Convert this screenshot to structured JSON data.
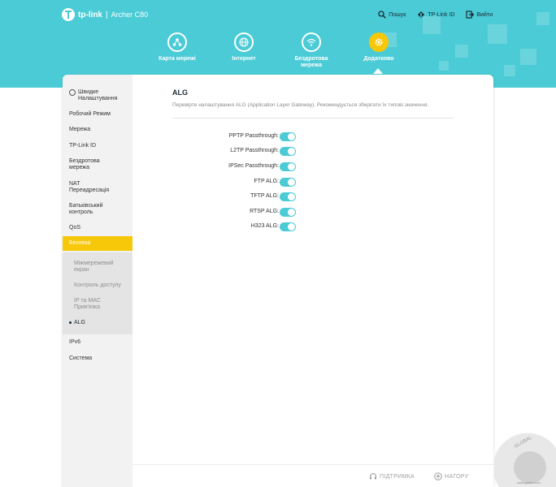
{
  "brand": {
    "name": "tp-link",
    "separator": "|",
    "model": "Archer C80"
  },
  "top_links": [
    {
      "label": "Пошук",
      "icon": "search-icon"
    },
    {
      "label": "TP-Link ID",
      "icon": "tplink-id-icon"
    },
    {
      "label": "Вийти",
      "icon": "logout-icon"
    }
  ],
  "nav": [
    {
      "label": "Карта мережі",
      "icon": "network-map-icon"
    },
    {
      "label": "Інтернет",
      "icon": "globe-icon"
    },
    {
      "label": "Бездротова мережа",
      "icon": "wifi-icon"
    },
    {
      "label": "Додатково",
      "icon": "gear-icon",
      "active": true
    }
  ],
  "sidebar": {
    "items": [
      {
        "label": "Швидке Налаштування"
      },
      {
        "label": "Робочий Режим"
      },
      {
        "label": "Мережа"
      },
      {
        "label": "TP-Link ID"
      },
      {
        "label": "Бездротова мережа"
      },
      {
        "label": "NAT Переадресація"
      },
      {
        "label": "Батьківський контроль"
      },
      {
        "label": "QoS"
      },
      {
        "label": "Безпека",
        "active": true
      },
      {
        "label": "IPv6"
      },
      {
        "label": "Система"
      }
    ],
    "sub_items": [
      {
        "label": "Міжмережевий екран"
      },
      {
        "label": "Контроль доступу"
      },
      {
        "label": "IP та MAC Прив'язка"
      },
      {
        "label": "ALG",
        "active": true
      }
    ]
  },
  "main": {
    "title": "ALG",
    "description": "Перевірте налаштування ALG (Application Layer Gateway). Рекомендується зберігати їх типові значення.",
    "settings": [
      {
        "label": "PPTP Passthrough:",
        "enabled": true
      },
      {
        "label": "L2TP Passthrough:",
        "enabled": true
      },
      {
        "label": "IPSec Passthrough:",
        "enabled": true
      },
      {
        "label": "FTP ALG:",
        "enabled": true
      },
      {
        "label": "TFTP ALG:",
        "enabled": true
      },
      {
        "label": "RTSP ALG:",
        "enabled": true
      },
      {
        "label": "H323 ALG:",
        "enabled": true
      }
    ]
  },
  "footer": {
    "support": "ПІДТРИМКА",
    "top": "НАГОРУ"
  },
  "watermark": {
    "text": "GLOBAL",
    "site": "www.geeks.com"
  },
  "colors": {
    "accent": "#4acbd6",
    "active": "#f7c70a"
  }
}
